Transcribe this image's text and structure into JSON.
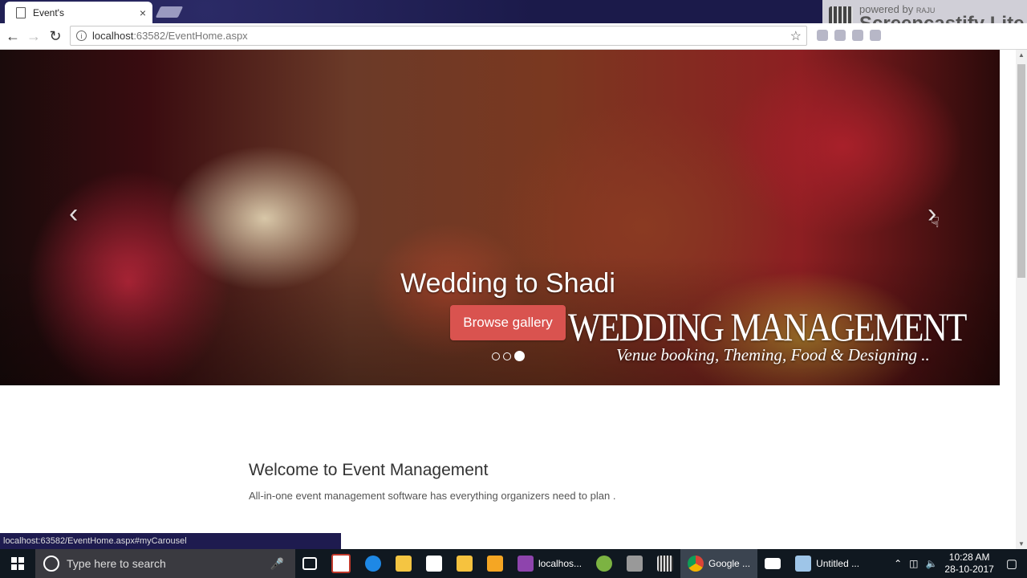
{
  "browser": {
    "tab_title": "Event's",
    "tab_close": "×",
    "url_host": "localhost",
    "url_rest": ":63582/EventHome.aspx",
    "status_url": "localhost:63582/EventHome.aspx#myCarousel"
  },
  "watermark": {
    "line1": "powered by",
    "user": "RAJU",
    "line2": "Screencastify Lite"
  },
  "carousel": {
    "caption_title": "Wedding to Shadi",
    "button_label": "Browse gallery",
    "overlay_title": "WEDDING MANAGEMENT",
    "overlay_subtitle": "Venue booking, Theming, Food & Designing ..",
    "prev_glyph": "‹",
    "next_glyph": "›",
    "slide_count": 3,
    "active_slide": 3
  },
  "welcome": {
    "title": "Welcome to Event Management",
    "text": "All-in-one event management software has everything organizers need to plan ."
  },
  "taskbar": {
    "search_placeholder": "Type here to search",
    "item_localhost": "localhos...",
    "item_google": "Google ...",
    "item_untitled": "Untitled ...",
    "time": "10:28 AM",
    "date": "28-10-2017"
  }
}
